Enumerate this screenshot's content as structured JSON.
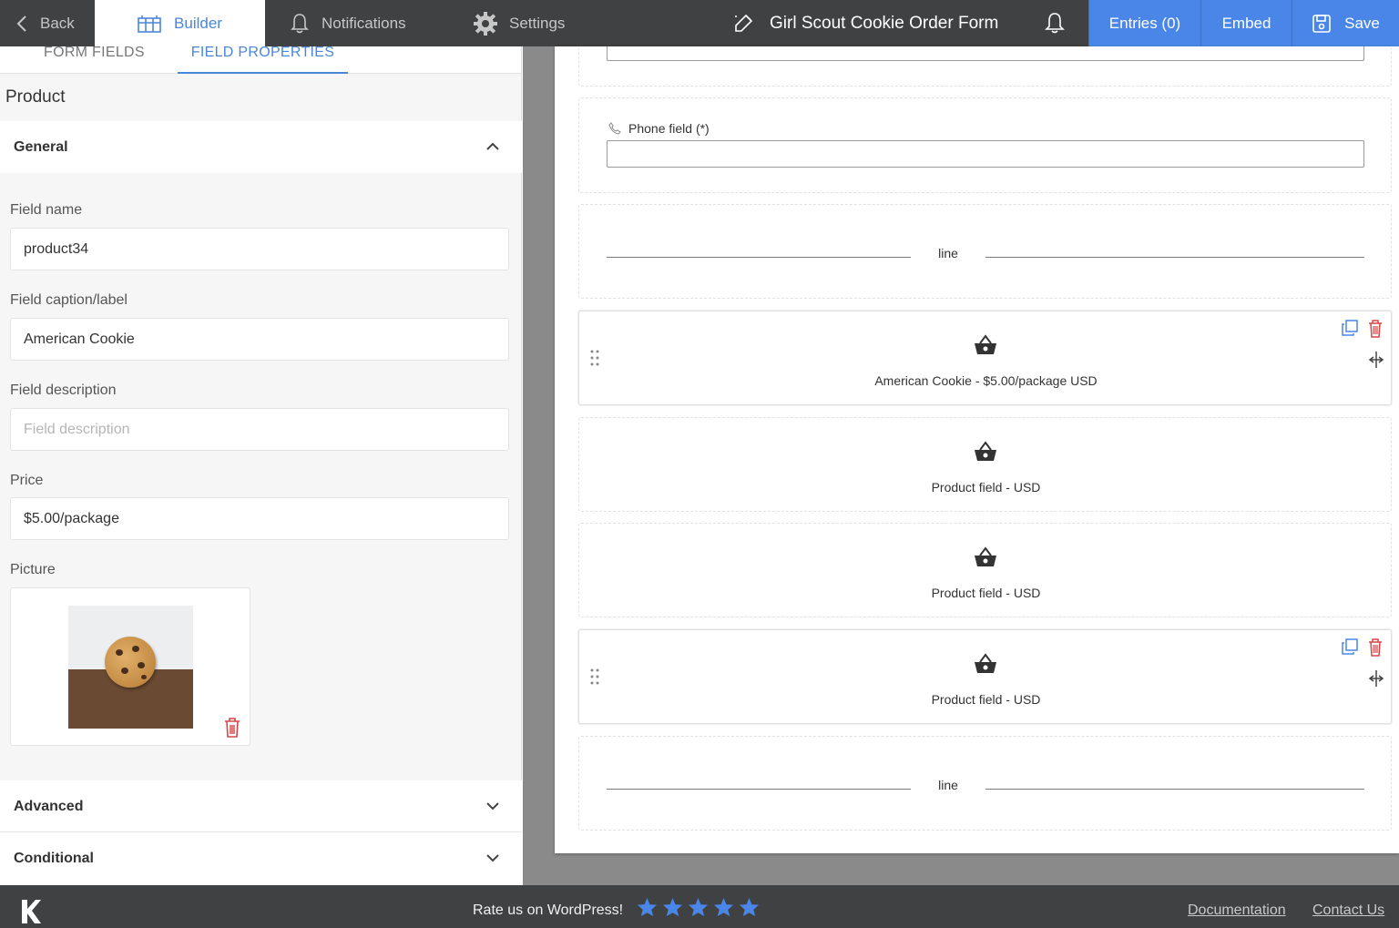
{
  "topbar": {
    "back_label": "Back",
    "builder_label": "Builder",
    "notifications_label": "Notifications",
    "settings_label": "Settings",
    "form_title": "Girl Scout Cookie Order Form",
    "entries_label": "Entries (0)",
    "embed_label": "Embed",
    "save_label": "Save",
    "accent_color": "#4a86e8"
  },
  "left": {
    "tabs": [
      "FORM FIELDS",
      "FIELD PROPERTIES"
    ],
    "active_tab": "FIELD PROPERTIES",
    "section_title": "Product",
    "general_label": "General",
    "fields": {
      "field_name_label": "Field name",
      "field_name_value": "product34",
      "caption_label": "Field caption/label",
      "caption_value": "American Cookie",
      "description_label": "Field description",
      "description_placeholder": "Field description",
      "price_label": "Price",
      "price_value": "$5.00/package",
      "picture_label": "Picture"
    },
    "advanced_label": "Advanced",
    "conditional_label": "Conditional"
  },
  "canvas": {
    "phone_label": "Phone field (*)",
    "line_text": "line",
    "products": [
      "American Cookie - $5.00/package USD",
      "Product field - USD",
      "Product field - USD",
      "Product field - USD"
    ]
  },
  "footer": {
    "rate_text": "Rate us on WordPress!",
    "stars": 5,
    "documentation": "Documentation",
    "contact": "Contact Us",
    "star_color": "#4a86e8"
  }
}
